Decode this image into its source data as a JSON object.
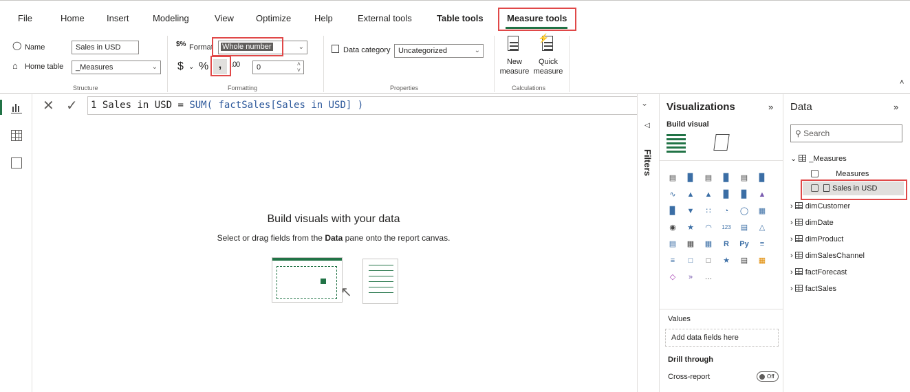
{
  "menu": {
    "items": [
      "File",
      "Home",
      "Insert",
      "Modeling",
      "View",
      "Optimize",
      "Help",
      "External tools",
      "Table tools",
      "Measure tools"
    ]
  },
  "ribbon": {
    "structure": {
      "name_label": "Name",
      "name_value": "Sales in USD",
      "home_table_label": "Home table",
      "home_table_value": "_Measures",
      "group_label": "Structure"
    },
    "formatting": {
      "format_label": "Format",
      "format_value": "Whole number",
      "currency_symbol": "$",
      "percent_symbol": "%",
      "comma_symbol": ",",
      "decimals_value": "0",
      "group_label": "Formatting"
    },
    "properties": {
      "data_category_label": "Data category",
      "data_category_value": "Uncategorized",
      "group_label": "Properties"
    },
    "calculations": {
      "new_measure_line1": "New",
      "new_measure_line2": "measure",
      "quick_measure_line1": "Quick",
      "quick_measure_line2": "measure",
      "group_label": "Calculations"
    }
  },
  "formula": {
    "line_no": "1",
    "name": "Sales in USD",
    "equals": " = ",
    "fn": "SUM",
    "args": "( factSales[Sales in USD] )"
  },
  "canvas": {
    "title": "Build visuals with your data",
    "sub_prefix": "Select or drag fields from the ",
    "sub_bold": "Data",
    "sub_suffix": " pane onto the report canvas."
  },
  "filters": {
    "label": "Filters"
  },
  "visualizations": {
    "title": "Visualizations",
    "build_visual": "Build visual",
    "values_label": "Values",
    "add_fields": "Add data fields here",
    "drill_through": "Drill through",
    "cross_report": "Cross-report",
    "toggle_state": "Off"
  },
  "data_pane": {
    "title": "Data",
    "search_placeholder": "Search",
    "tables": [
      {
        "name": "_Measures",
        "expanded": true
      },
      {
        "name": "dimCustomer"
      },
      {
        "name": "dimDate"
      },
      {
        "name": "dimProduct"
      },
      {
        "name": "dimSalesChannel"
      },
      {
        "name": "factForecast"
      },
      {
        "name": "factSales"
      }
    ],
    "measures_folder": "Measures",
    "selected_measure": "Sales in USD"
  },
  "colors": {
    "accent": "#118dff",
    "highlight": "#e04848",
    "teal": "#217346"
  }
}
